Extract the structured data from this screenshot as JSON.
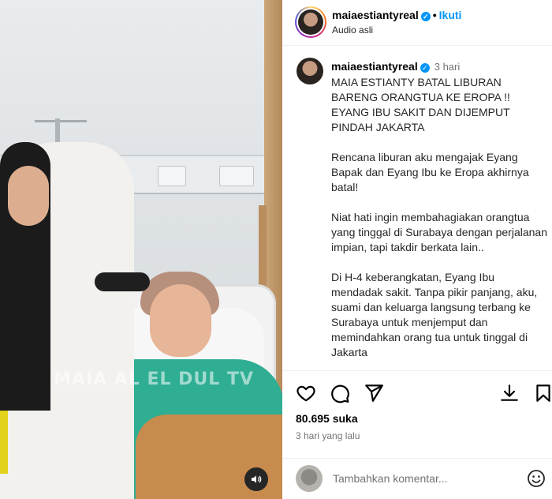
{
  "media": {
    "watermark": "MAIA AL EL DUL TV",
    "audio_button_icon": "speaker-icon"
  },
  "header": {
    "username": "maiaestiantyreal",
    "separator": "•",
    "follow_label": "Ikuti",
    "audio_label": "Audio asli"
  },
  "caption": {
    "username": "maiaestiantyreal",
    "time": "3 hari",
    "paragraphs": [
      "MAIA ESTIANTY BATAL LIBURAN BARENG ORANGTUA KE EROPA !! EYANG IBU SAKIT DAN DIJEMPUT PINDAH JAKARTA",
      "Rencana liburan aku mengajak Eyang Bapak dan Eyang Ibu ke Eropa akhirnya batal!",
      "Niat hati ingin membahagiakan orangtua yang tinggal di Surabaya dengan perjalanan impian, tapi takdir berkata lain..",
      "Di H-4 keberangkatan, Eyang Ibu mendadak sakit. Tanpa pikir panjang, aku, suami dan keluarga langsung terbang ke Surabaya untuk menjemput dan memindahkan orang tua untuk tinggal di Jakarta"
    ]
  },
  "actions": {
    "icons": [
      "heart-icon",
      "comment-icon",
      "share-icon",
      "download-icon",
      "bookmark-icon"
    ],
    "likes": "80.695 suka",
    "posted_ago": "3 hari yang lalu"
  },
  "comment": {
    "placeholder": "Tambahkan komentar...",
    "emoji_icon": "emoji-icon"
  },
  "colors": {
    "accent": "#0095f6",
    "muted": "#737373",
    "gown": "#2fae94",
    "blanket": "#c88b4e"
  }
}
